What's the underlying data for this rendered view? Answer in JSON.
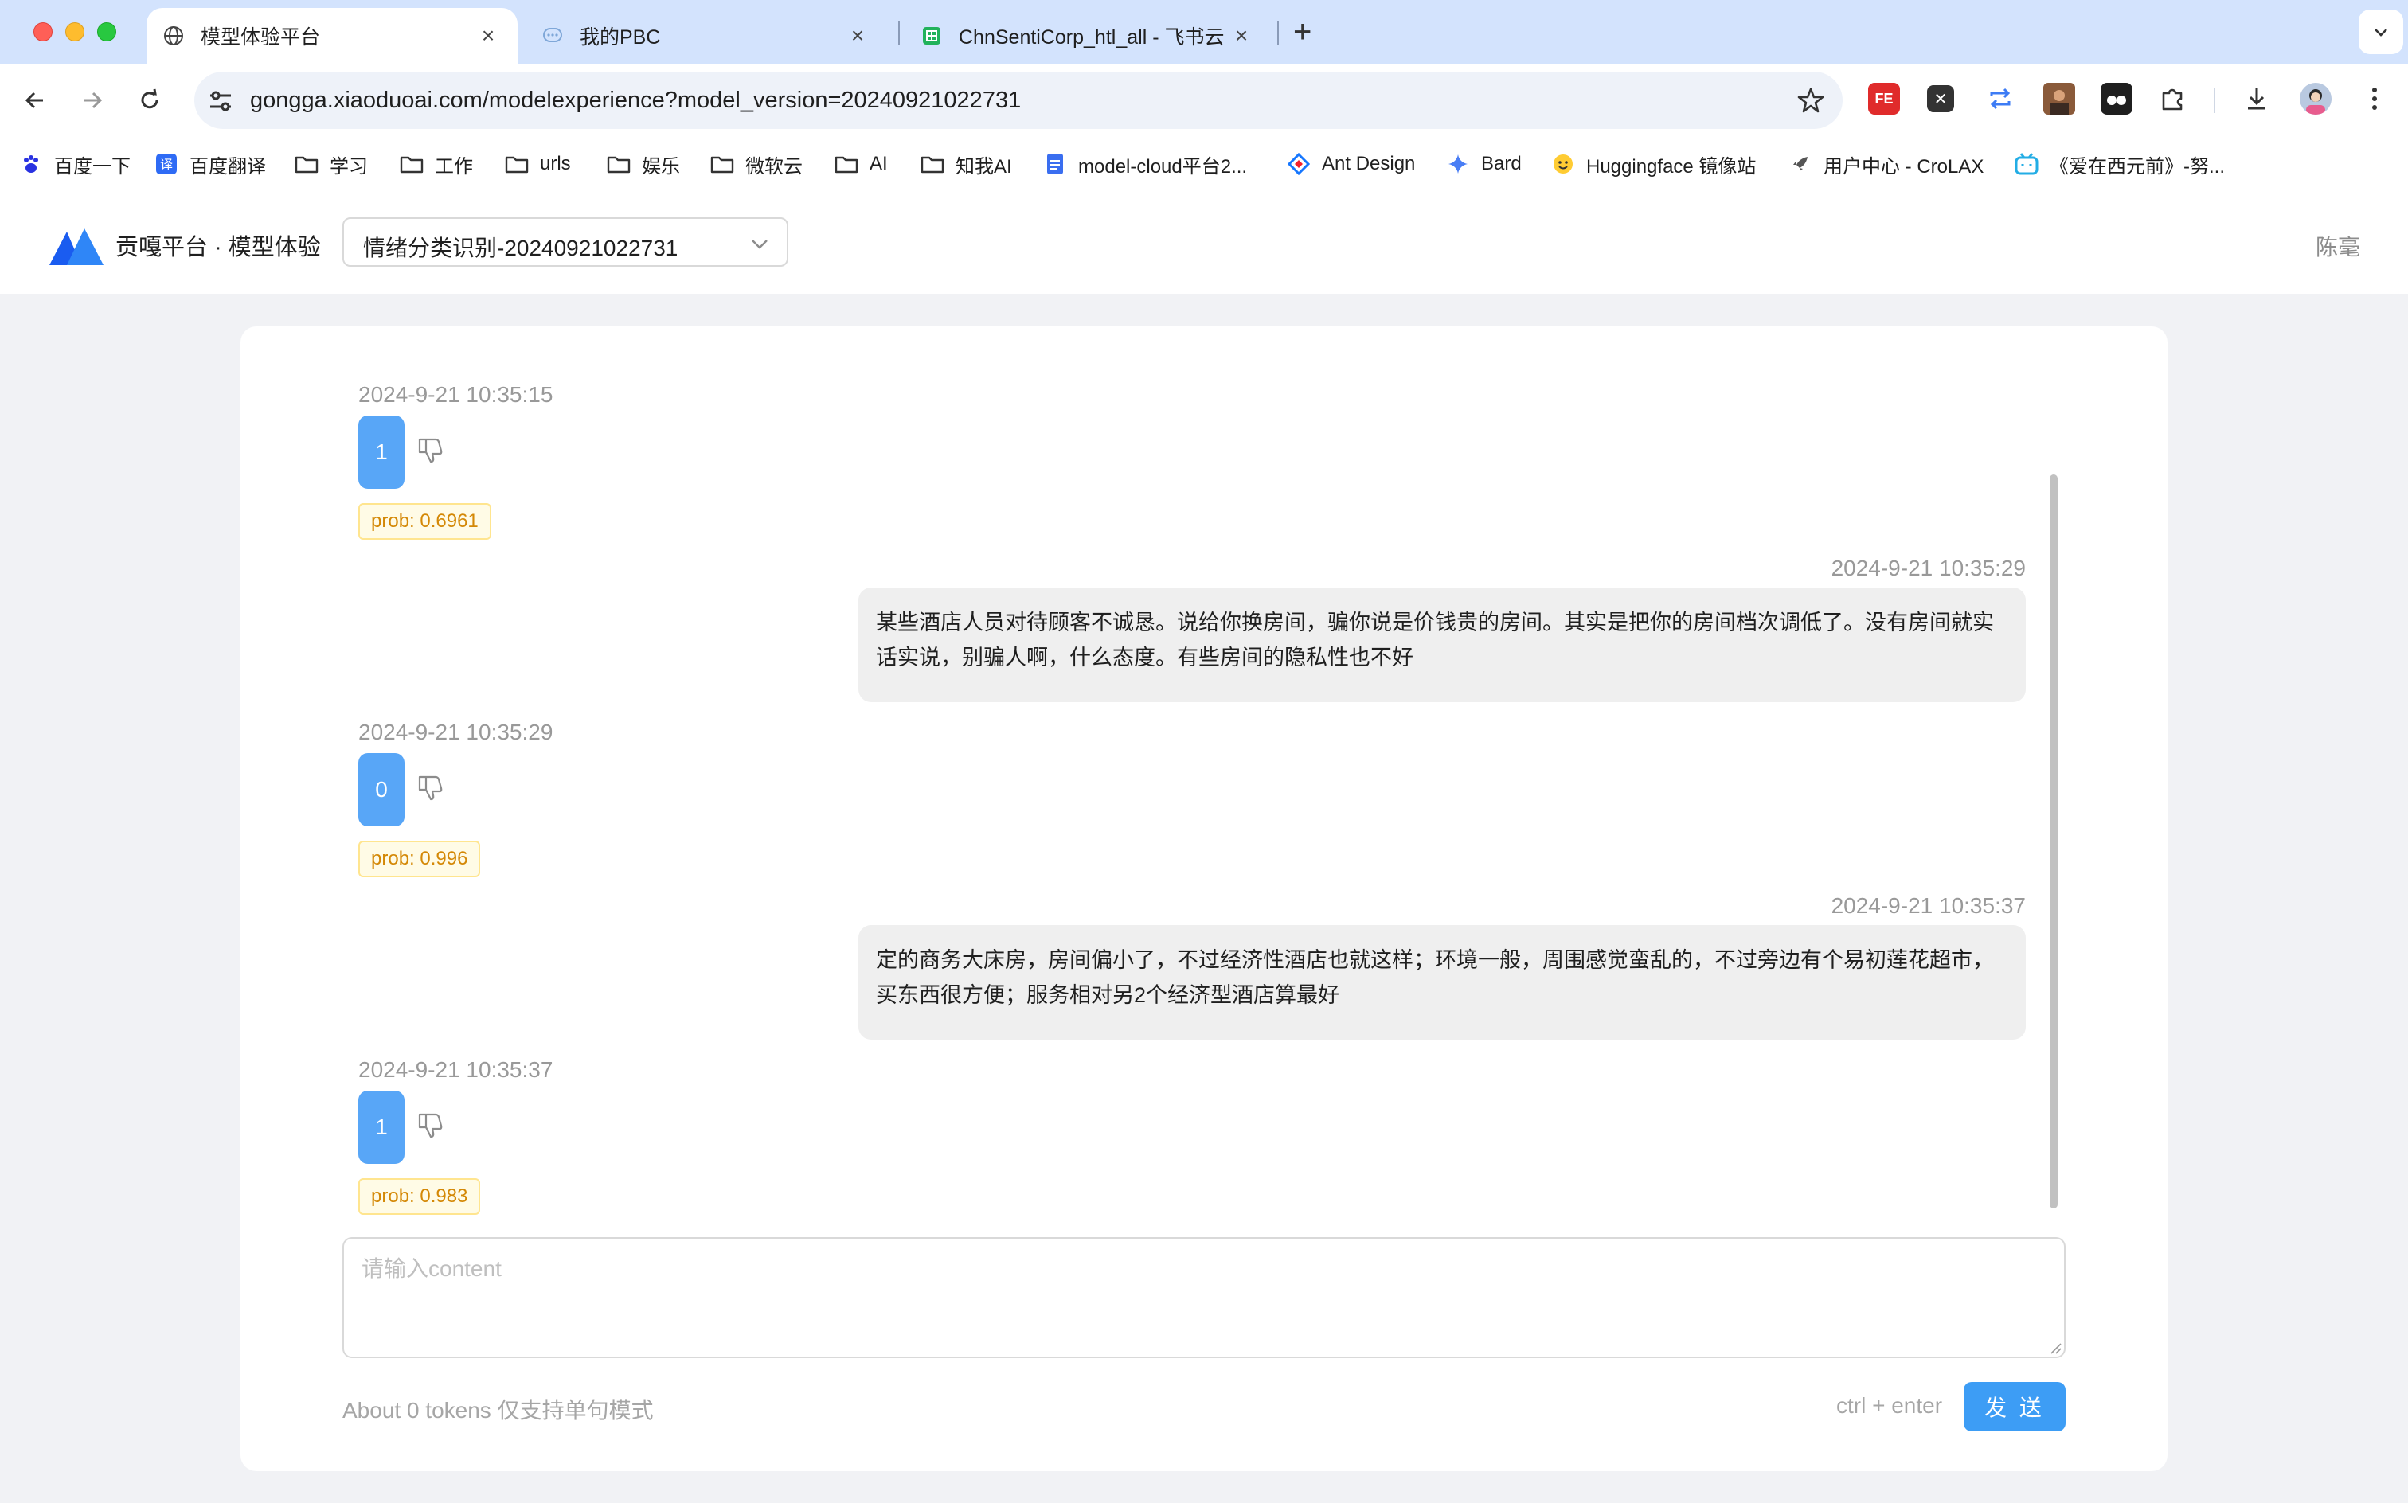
{
  "browser": {
    "tabs": [
      {
        "title": "模型体验平台",
        "icon": "globe-icon",
        "active": true
      },
      {
        "title": "我的PBC",
        "icon": "chat-bubble-icon",
        "active": false
      },
      {
        "title": "ChnSentiCorp_htl_all - 飞书云",
        "icon": "sheet-icon",
        "active": false
      }
    ],
    "new_tab_label": "+",
    "url": "gongga.xiaoduoai.com/modelexperience?model_version=20240921022731",
    "bookmarks": [
      {
        "label": "百度一下",
        "icon": "baidu-paw-icon"
      },
      {
        "label": "百度翻译",
        "icon": "translate-icon"
      },
      {
        "label": "学习",
        "icon": "folder-icon"
      },
      {
        "label": "工作",
        "icon": "folder-icon"
      },
      {
        "label": "urls",
        "icon": "folder-icon"
      },
      {
        "label": "娱乐",
        "icon": "folder-icon"
      },
      {
        "label": "微软云",
        "icon": "folder-icon"
      },
      {
        "label": "AI",
        "icon": "folder-icon"
      },
      {
        "label": "知我AI",
        "icon": "folder-icon"
      },
      {
        "label": "model-cloud平台2...",
        "icon": "doc-icon"
      },
      {
        "label": "Ant Design",
        "icon": "ant-design-icon"
      },
      {
        "label": "Bard",
        "icon": "sparkle-icon"
      },
      {
        "label": "Huggingface 镜像站",
        "icon": "hugging-face-icon"
      },
      {
        "label": "用户中心 - CroLAX",
        "icon": "rocket-icon"
      },
      {
        "label": "《爱在西元前》-努...",
        "icon": "bilibili-icon"
      }
    ],
    "colors": {
      "tabstrip": "#d3e3fd",
      "omnibox": "#eef2f9"
    }
  },
  "app": {
    "name": "贡嘎平台 · 模型体验",
    "model_select_value": "情绪分类识别-20240921022731",
    "user_name": "陈毫",
    "accent": "#3d9df5"
  },
  "chat": {
    "messages": [
      {
        "role": "bot",
        "time": "2024-9-21 10:35:15",
        "label": "1",
        "prob": "prob: 0.6961"
      },
      {
        "role": "user",
        "time": "2024-9-21 10:35:29",
        "text": "某些酒店人员对待顾客不诚恳。说给你换房间，骗你说是价钱贵的房间。其实是把你的房间档次调低了。没有房间就实话实说，别骗人啊，什么态度。有些房间的隐私性也不好"
      },
      {
        "role": "bot",
        "time": "2024-9-21 10:35:29",
        "label": "0",
        "prob": "prob: 0.996"
      },
      {
        "role": "user",
        "time": "2024-9-21 10:35:37",
        "text": "定的商务大床房，房间偏小了，不过经济性酒店也就这样；环境一般，周围感觉蛮乱的，不过旁边有个易初莲花超市，买东西很方便；服务相对另2个经济型酒店算最好"
      },
      {
        "role": "bot",
        "time": "2024-9-21 10:35:37",
        "label": "1",
        "prob": "prob: 0.983"
      }
    ]
  },
  "composer": {
    "placeholder": "请输入content",
    "value": "",
    "token_hint": "About 0 tokens 仅支持单句模式",
    "shortcut": "ctrl + enter",
    "send_label": "发 送"
  }
}
